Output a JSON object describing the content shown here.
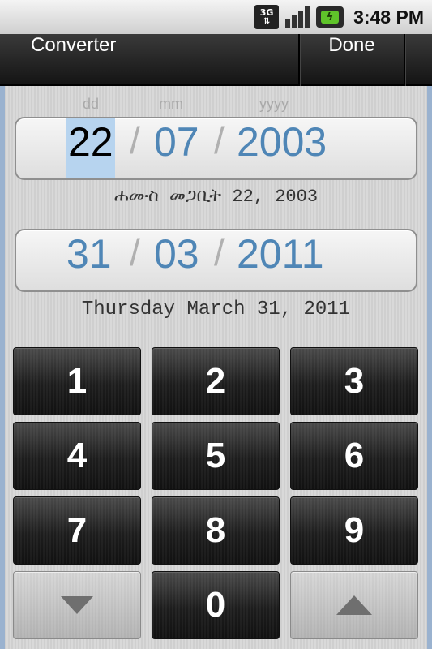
{
  "status": {
    "network": "3G",
    "time": "3:48 PM"
  },
  "titlebar": {
    "title": "Converter",
    "done_label": "Done"
  },
  "labels": {
    "day": "dd",
    "month": "mm",
    "year": "yyyy"
  },
  "ethiopian_date": {
    "day": "22",
    "month": "07",
    "year": "2003",
    "separator": "/",
    "caption": "ሐሙስ መጋቢት 22, 2003"
  },
  "gregorian_date": {
    "day": "31",
    "month": "03",
    "year": "2011",
    "separator": "/",
    "caption": "Thursday March 31, 2011"
  },
  "keypad": {
    "k1": "1",
    "k2": "2",
    "k3": "3",
    "k4": "4",
    "k5": "5",
    "k6": "6",
    "k7": "7",
    "k8": "8",
    "k9": "9",
    "k0": "0",
    "down_icon": "triangle-down-icon",
    "up_icon": "triangle-up-icon"
  },
  "colors": {
    "date_text": "#4f86b6",
    "selection": "#b7d4ef",
    "frame": "#9ab2cf"
  }
}
